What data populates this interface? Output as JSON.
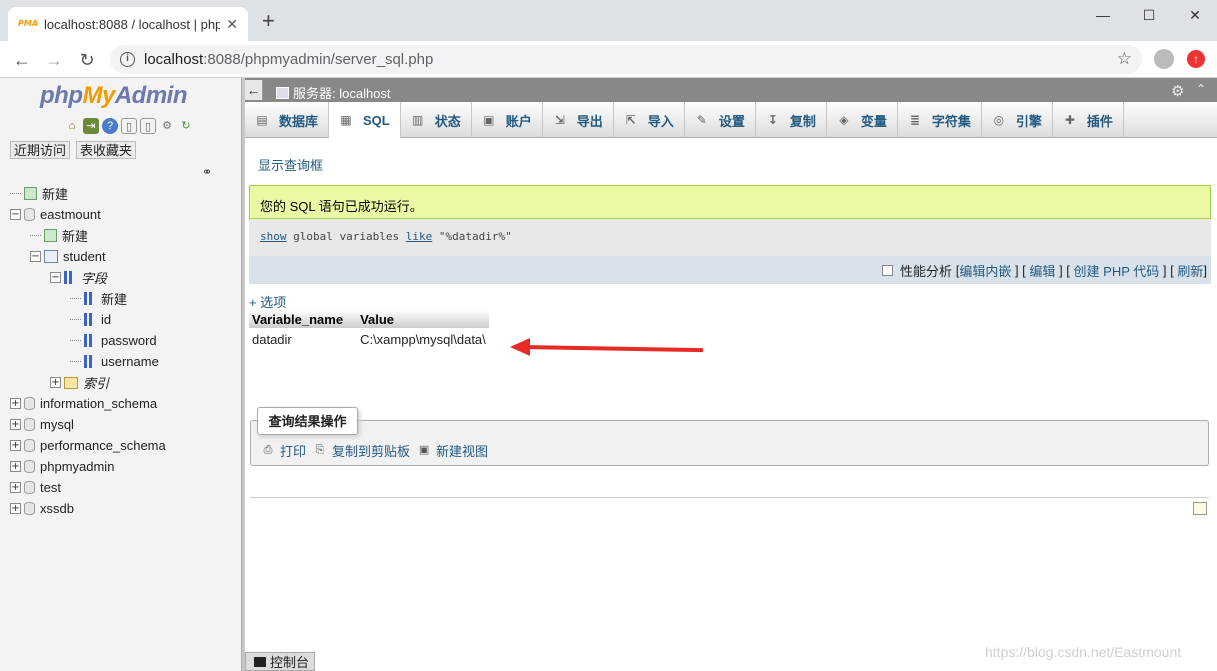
{
  "browser": {
    "tab_title": "localhost:8088 / localhost | php",
    "favicon_text": "PMA",
    "tab_close": "✕",
    "new_tab": "+",
    "url_host": "localhost",
    "url_path": ":8088/phpmyadmin/server_sql.php",
    "window_controls": [
      "—",
      "☐",
      "✕"
    ],
    "nav": {
      "back": "←",
      "forward": "→",
      "reload": "↻"
    },
    "star": "☆"
  },
  "sidebar": {
    "logo": {
      "php": "php",
      "my": "My",
      "admin": "Admin"
    },
    "navlinks": [
      "近期访问",
      "表收藏夹"
    ],
    "link_icon": "⚭",
    "tree": [
      {
        "id": "new-root",
        "label": "新建",
        "type": "new",
        "indent": 0
      },
      {
        "id": "eastmount",
        "label": "eastmount",
        "type": "db",
        "indent": 0,
        "toggle": "−"
      },
      {
        "id": "eastmount-new",
        "label": "新建",
        "type": "new",
        "indent": 1
      },
      {
        "id": "student",
        "label": "student",
        "type": "table",
        "indent": 1,
        "toggle": "−"
      },
      {
        "id": "fields",
        "label": "字段",
        "type": "cols",
        "indent": 2,
        "toggle": "−",
        "italic": true
      },
      {
        "id": "fields-new",
        "label": "新建",
        "type": "cols",
        "indent": 3
      },
      {
        "id": "col-id",
        "label": "id",
        "type": "cols",
        "indent": 3
      },
      {
        "id": "col-password",
        "label": "password",
        "type": "cols",
        "indent": 3
      },
      {
        "id": "col-username",
        "label": "username",
        "type": "cols",
        "indent": 3
      },
      {
        "id": "indexes",
        "label": "索引",
        "type": "idx",
        "indent": 2,
        "toggle": "+",
        "italic": true
      },
      {
        "id": "information_schema",
        "label": "information_schema",
        "type": "db",
        "indent": 0,
        "toggle": "+"
      },
      {
        "id": "mysql",
        "label": "mysql",
        "type": "db",
        "indent": 0,
        "toggle": "+"
      },
      {
        "id": "performance_schema",
        "label": "performance_schema",
        "type": "db",
        "indent": 0,
        "toggle": "+"
      },
      {
        "id": "phpmyadmin",
        "label": "phpmyadmin",
        "type": "db",
        "indent": 0,
        "toggle": "+"
      },
      {
        "id": "test",
        "label": "test",
        "type": "db",
        "indent": 0,
        "toggle": "+"
      },
      {
        "id": "xssdb",
        "label": "xssdb",
        "type": "db",
        "indent": 0,
        "toggle": "+"
      }
    ]
  },
  "server_bar": {
    "label": "服务器: localhost",
    "back": "←",
    "gear": "⚙",
    "collapse": "⌃"
  },
  "menu": [
    {
      "id": "databases",
      "label": "数据库",
      "icon": "▤"
    },
    {
      "id": "sql",
      "label": "SQL",
      "icon": "▦",
      "active": true
    },
    {
      "id": "status",
      "label": "状态",
      "icon": "▥"
    },
    {
      "id": "accounts",
      "label": "账户",
      "icon": "▣"
    },
    {
      "id": "export",
      "label": "导出",
      "icon": "⇲"
    },
    {
      "id": "import",
      "label": "导入",
      "icon": "⇱"
    },
    {
      "id": "settings",
      "label": "设置",
      "icon": "✎"
    },
    {
      "id": "replication",
      "label": "复制",
      "icon": "↧"
    },
    {
      "id": "variables",
      "label": "变量",
      "icon": "◈"
    },
    {
      "id": "charsets",
      "label": "字符集",
      "icon": "≣"
    },
    {
      "id": "engines",
      "label": "引擎",
      "icon": "◎"
    },
    {
      "id": "plugins",
      "label": "插件",
      "icon": "✚"
    }
  ],
  "content": {
    "show_query_box": "显示查询框",
    "success_message": "您的 SQL 语句已成功运行。",
    "sql": {
      "kw1": "show",
      "mid": " global variables ",
      "kw2": "like",
      "str": " \"%datadir%\""
    },
    "actions": {
      "profiling": "性能分析",
      "lb1": "[",
      "edit_inline": "编辑内嵌",
      "sep1": "] [",
      "edit": "编辑",
      "sep2": "] [",
      "create_php": "创建 PHP 代码",
      "sep3": "] [",
      "refresh": "刷新",
      "rb": "]"
    },
    "options": "+ 选项",
    "table": {
      "headers": [
        "Variable_name",
        "Value"
      ],
      "rows": [
        [
          "datadir",
          "C:\\xampp\\mysql\\data\\"
        ]
      ]
    },
    "query_ops": {
      "legend": "查询结果操作",
      "print": "打印",
      "copy": "复制到剪贴板",
      "new_view": "新建视图"
    },
    "console": "控制台",
    "watermark": "https://blog.csdn.net/Eastmount"
  },
  "colors": {
    "accent": "#235a81",
    "success_bg": "#ebf8a4",
    "arrow": "#e62a24"
  }
}
